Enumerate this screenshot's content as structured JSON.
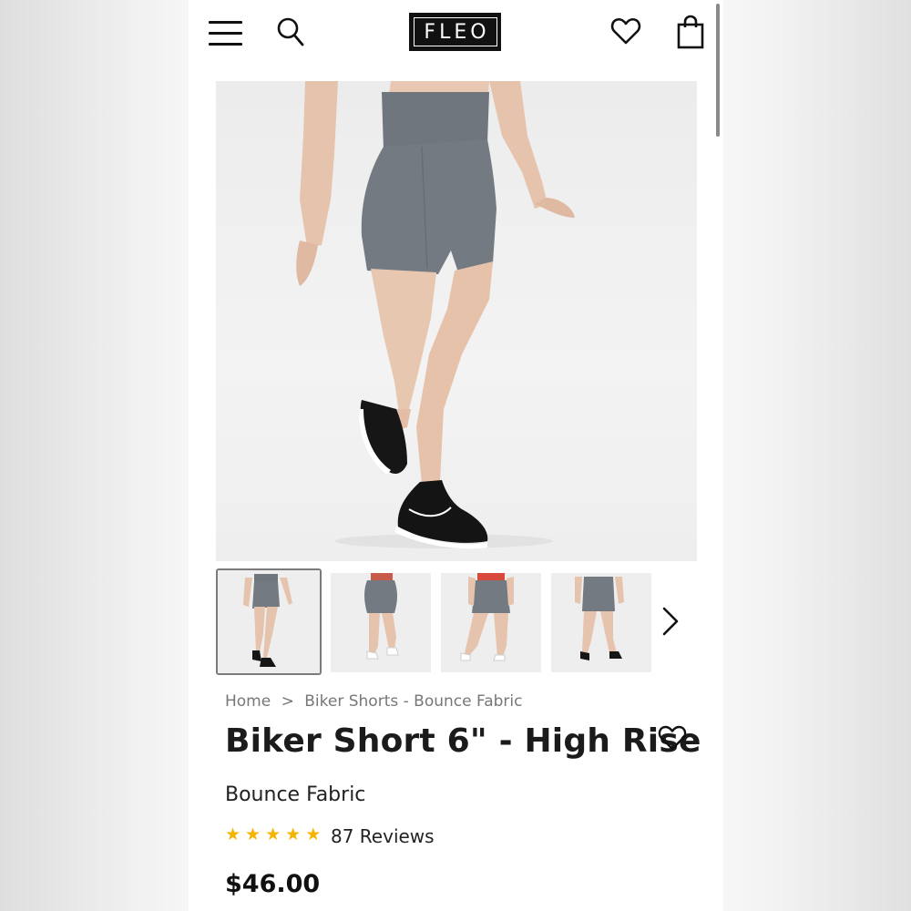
{
  "header": {
    "logo_text": "FLEO",
    "icons": [
      "menu-icon",
      "search-icon",
      "heart-icon",
      "shopping-bag-icon"
    ]
  },
  "gallery": {
    "thumbnail_count_visible": 4,
    "active_index": 0
  },
  "breadcrumb": {
    "home": "Home",
    "separator": ">",
    "category": "Biker Shorts - Bounce Fabric"
  },
  "product": {
    "title": "Biker Short 6\" - High Rise",
    "subtitle": "Bounce Fabric",
    "rating_stars": 5,
    "reviews_label": "87 Reviews",
    "price": "$46.00"
  },
  "colors": {
    "star": "#f4b400",
    "short_gray": "#737a82"
  }
}
